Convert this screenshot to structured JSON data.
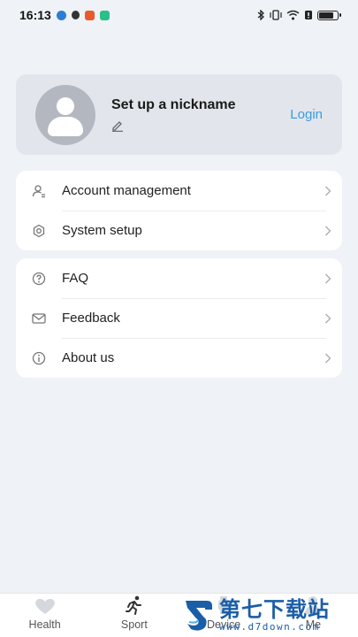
{
  "status_bar": {
    "time": "16:13",
    "battery_level": 0.8,
    "notification_colors": [
      "#2a7fd4",
      "#e65a2c",
      "#f0a23a",
      "#2bbf8a"
    ]
  },
  "profile": {
    "nickname": "Set up a nickname",
    "login_label": "Login"
  },
  "menu": {
    "group1": [
      {
        "label": "Account management",
        "icon": "user-icon"
      },
      {
        "label": "System setup",
        "icon": "settings-icon"
      }
    ],
    "group2": [
      {
        "label": "FAQ",
        "icon": "question-icon"
      },
      {
        "label": "Feedback",
        "icon": "mail-icon"
      },
      {
        "label": "About us",
        "icon": "info-icon"
      }
    ]
  },
  "bottom_nav": {
    "items": [
      {
        "label": "Health",
        "icon": "heart-icon"
      },
      {
        "label": "Sport",
        "icon": "running-icon"
      },
      {
        "label": "Device",
        "icon": "watch-icon"
      },
      {
        "label": "Me",
        "icon": "person-icon"
      }
    ]
  },
  "watermark": {
    "title": "第七下载站",
    "url": "www.d7down.com"
  },
  "colors": {
    "accent": "#3a9be0",
    "background": "#eff2f6",
    "card": "#e2e6ec"
  }
}
